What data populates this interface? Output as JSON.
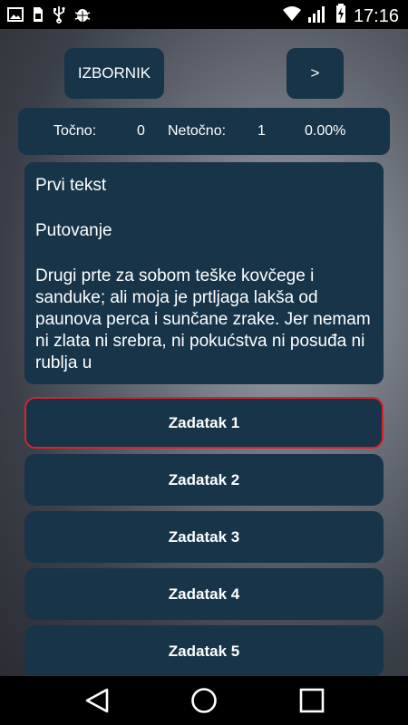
{
  "status_bar": {
    "time": "17:16",
    "left_icons": [
      "image-icon",
      "sim-icon",
      "usb-icon",
      "android-debug-icon"
    ],
    "right_icons": [
      "wifi-icon",
      "signal-icon",
      "battery-charging-icon"
    ]
  },
  "toolbar": {
    "menu_label": "IZBORNIK",
    "next_label": ">"
  },
  "score": {
    "correct_label": "Točno:",
    "correct_value": "0",
    "incorrect_label": "Netočno:",
    "incorrect_value": "1",
    "percent": "0.00%"
  },
  "text": {
    "heading": "Prvi tekst",
    "title": "Putovanje",
    "body": "Drugi prte za sobom teške kovčege i sanduke; ali moja je prtljaga lakša od paunova perca i sunčane zrake. Jer nemam ni zlata ni srebra, ni pokućstva ni posuđa ni rublja u"
  },
  "tasks": [
    {
      "label": "Zadatak 1",
      "selected": true
    },
    {
      "label": "Zadatak 2",
      "selected": false
    },
    {
      "label": "Zadatak 3",
      "selected": false
    },
    {
      "label": "Zadatak 4",
      "selected": false
    },
    {
      "label": "Zadatak 5",
      "selected": false
    }
  ],
  "colors": {
    "card": "#173449",
    "selected_border": "#d9212c"
  },
  "nav_bar": {
    "icons": [
      "back-icon",
      "home-icon",
      "recents-icon"
    ]
  }
}
